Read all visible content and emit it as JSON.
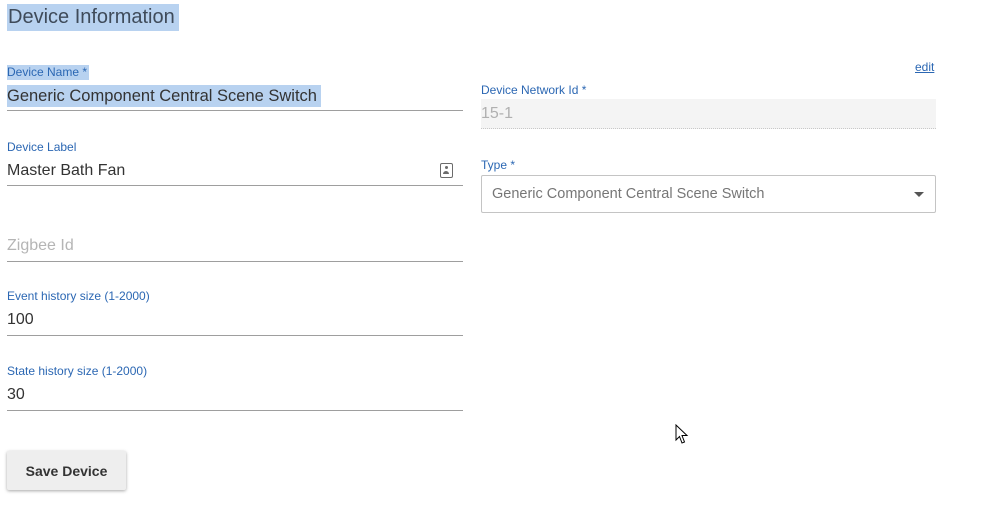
{
  "section": {
    "title": "Device Information"
  },
  "device_name": {
    "label": "Device Name *",
    "value": "Generic Component Central Scene Switch"
  },
  "device_label": {
    "label": "Device Label",
    "value": "Master Bath Fan",
    "icon": "contact-card-icon"
  },
  "zigbee": {
    "placeholder": "Zigbee Id",
    "value": ""
  },
  "event_history": {
    "label": "Event history size (1-2000)",
    "value": "100"
  },
  "state_history": {
    "label": "State history size (1-2000)",
    "value": "30"
  },
  "edit_link": "edit",
  "network_id": {
    "label": "Device Network Id *",
    "value": "15-1"
  },
  "type": {
    "label": "Type *",
    "selected": "Generic Component Central Scene Switch",
    "icon": "chevron-down-icon"
  },
  "save_button": "Save Device",
  "colors": {
    "label_blue": "#2b67b3",
    "selection": "#b8d2f0",
    "underline": "#9e9e9e",
    "button_bg": "#eeeeee"
  }
}
